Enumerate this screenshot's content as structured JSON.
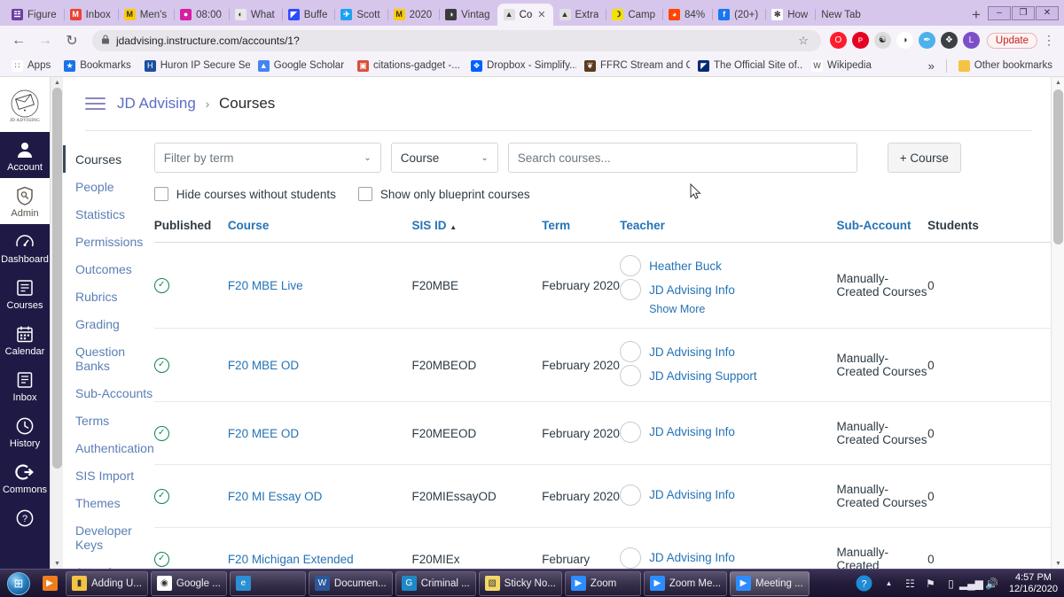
{
  "browser": {
    "tabs": [
      {
        "label": "Figure",
        "icon": "figure-icon",
        "color": "#6b3fa0",
        "glyph": "☳"
      },
      {
        "label": "Inbox",
        "icon": "gmail-icon",
        "color": "#ea4335",
        "glyph": "M"
      },
      {
        "label": "Men's",
        "icon": "mgo-icon",
        "color": "#ffcb05",
        "glyph": "M"
      },
      {
        "label": "08:00",
        "icon": "clock-icon",
        "color": "#d61fa1",
        "glyph": "●"
      },
      {
        "label": "What",
        "icon": "cloud-icon",
        "color": "#e8e8e8",
        "glyph": "◐"
      },
      {
        "label": "Buffe",
        "icon": "buffer-icon",
        "color": "#2c4bff",
        "glyph": "◤"
      },
      {
        "label": "Scott",
        "icon": "twitter-icon",
        "color": "#1da1f2",
        "glyph": "✈"
      },
      {
        "label": "2020",
        "icon": "mgo-icon",
        "color": "#ffcb05",
        "glyph": "M"
      },
      {
        "label": "Vintag",
        "icon": "globe-icon",
        "color": "#3b3b3b",
        "glyph": "◑"
      },
      {
        "label": "Co",
        "icon": "canvas-icon",
        "color": "#e0e0e0",
        "glyph": "▲",
        "active": true,
        "closable": true
      },
      {
        "label": "Extra",
        "icon": "canvas-icon",
        "color": "#e0e0e0",
        "glyph": "▲"
      },
      {
        "label": "Camp",
        "icon": "camp-icon",
        "color": "#f2e200",
        "glyph": "☽"
      },
      {
        "label": "84%",
        "icon": "reddit-icon",
        "color": "#ff4500",
        "glyph": "◕"
      },
      {
        "label": "(20+)",
        "icon": "facebook-icon",
        "color": "#1877f2",
        "glyph": "f"
      },
      {
        "label": "How",
        "icon": "spinner-icon",
        "color": "#ffffff",
        "glyph": "✻"
      },
      {
        "label": "New Tab",
        "icon": "newtab-icon",
        "color": "#f5f2f9",
        "glyph": ""
      }
    ],
    "new_tab_label": "+",
    "window_controls": {
      "minimize": "–",
      "maximize": "❐",
      "close": "✕"
    },
    "nav": {
      "back": "←",
      "forward": "→",
      "reload": "↻"
    },
    "url": "jdadvising.instructure.com/accounts/1?",
    "lock": "🔒",
    "star": "☆",
    "extensions": [
      {
        "name": "opera-extension",
        "color": "#ff1b2d",
        "glyph": "O"
      },
      {
        "name": "pinterest-extension",
        "color": "#e60023",
        "glyph": "ᴘ"
      },
      {
        "name": "grammarly-extension",
        "color": "#dcdcdc",
        "glyph": "☯"
      },
      {
        "name": "panda-extension",
        "color": "#ffffff",
        "glyph": "◑"
      },
      {
        "name": "honey-extension",
        "color": "#4db2ec",
        "glyph": "✒"
      },
      {
        "name": "puzzle-extension",
        "color": "#3c4043",
        "glyph": "❖"
      },
      {
        "name": "profile-avatar",
        "color": "#7b4fc9",
        "glyph": "L"
      }
    ],
    "update_label": "Update",
    "menu_glyph": "⋮",
    "bookmarks": [
      {
        "label": "Apps",
        "icon": "apps-grid-icon",
        "color": "#ffffff",
        "glyph": "∷"
      },
      {
        "label": "Bookmarks",
        "icon": "star-icon",
        "color": "#1a73e8",
        "glyph": "★"
      },
      {
        "label": "Huron IP Secure Se...",
        "icon": "huron-icon",
        "color": "#1a4fa0",
        "glyph": "H"
      },
      {
        "label": "Google Scholar",
        "icon": "scholar-icon",
        "color": "#4285f4",
        "glyph": "▲"
      },
      {
        "label": "citations-gadget -...",
        "icon": "citations-icon",
        "color": "#d94f3d",
        "glyph": "▣"
      },
      {
        "label": "Dropbox - Simplify...",
        "icon": "dropbox-icon",
        "color": "#0061ff",
        "glyph": "❖"
      },
      {
        "label": "FFRC Stream and C...",
        "icon": "ffrc-icon",
        "color": "#5c3b1e",
        "glyph": "❦"
      },
      {
        "label": "The Official Site of...",
        "icon": "mlb-icon",
        "color": "#002d72",
        "glyph": "◤"
      },
      {
        "label": "Wikipedia",
        "icon": "wikipedia-icon",
        "color": "#ffffff",
        "glyph": "W"
      }
    ],
    "overflow_label": "»",
    "other_bookmarks": {
      "label": "Other bookmarks",
      "icon": "folder-icon",
      "glyph": "▮"
    }
  },
  "canvas": {
    "global_nav": {
      "logo_text": "JD ADVISING",
      "items": [
        {
          "label": "Account",
          "icon": "user-icon",
          "active": false
        },
        {
          "label": "Admin",
          "icon": "shield-key-icon",
          "active": true
        },
        {
          "label": "Dashboard",
          "icon": "speedometer-icon",
          "active": false
        },
        {
          "label": "Courses",
          "icon": "book-icon",
          "active": false
        },
        {
          "label": "Calendar",
          "icon": "calendar-icon",
          "active": false
        },
        {
          "label": "Inbox",
          "icon": "envelope-icon",
          "active": false
        },
        {
          "label": "History",
          "icon": "clock-icon",
          "active": false
        },
        {
          "label": "Commons",
          "icon": "arrow-out-icon",
          "active": false
        },
        {
          "label": "",
          "icon": "help-question-icon",
          "active": false
        }
      ]
    },
    "breadcrumb": {
      "root": "JD Advising",
      "separator": "›",
      "current": "Courses"
    },
    "account_nav": [
      {
        "label": "Courses",
        "active": true
      },
      {
        "label": "People",
        "active": false
      },
      {
        "label": "Statistics",
        "active": false
      },
      {
        "label": "Permissions",
        "active": false
      },
      {
        "label": "Outcomes",
        "active": false
      },
      {
        "label": "Rubrics",
        "active": false
      },
      {
        "label": "Grading",
        "active": false
      },
      {
        "label": "Question Banks",
        "active": false
      },
      {
        "label": "Sub-Accounts",
        "active": false
      },
      {
        "label": "Terms",
        "active": false
      },
      {
        "label": "Authentication",
        "active": false
      },
      {
        "label": "SIS Import",
        "active": false
      },
      {
        "label": "Themes",
        "active": false
      },
      {
        "label": "Developer Keys",
        "active": false
      },
      {
        "label": "Attendance",
        "active": false
      }
    ],
    "filters": {
      "term_placeholder": "Filter by term",
      "type_value": "Course",
      "search_placeholder": "Search courses...",
      "add_course_label": "+ Course",
      "hide_without_students_label": "Hide courses without students",
      "blueprint_only_label": "Show only blueprint courses"
    },
    "table": {
      "columns": [
        "Published",
        "Course",
        "SIS ID",
        "Term",
        "Teacher",
        "Sub-Account",
        "Students"
      ],
      "sorted_column": "SIS ID",
      "sort_indicator": "▲",
      "show_more_label": "Show More",
      "rows": [
        {
          "published": true,
          "course": "F20 MBE Live",
          "sis_id": "F20MBE",
          "term": "February 2020",
          "teachers": [
            "Heather Buck",
            "JD Advising Info"
          ],
          "show_more": true,
          "sub_account": "Manually-Created Courses",
          "students": "0"
        },
        {
          "published": true,
          "course": "F20 MBE OD",
          "sis_id": "F20MBEOD",
          "term": "February 2020",
          "teachers": [
            "JD Advising Info",
            "JD Advising Support"
          ],
          "show_more": false,
          "sub_account": "Manually-Created Courses",
          "students": "0"
        },
        {
          "published": true,
          "course": "F20 MEE OD",
          "sis_id": "F20MEEOD",
          "term": "February 2020",
          "teachers": [
            "JD Advising Info"
          ],
          "show_more": false,
          "sub_account": "Manually-Created Courses",
          "students": "0"
        },
        {
          "published": true,
          "course": "F20 MI Essay OD",
          "sis_id": "F20MIEssayOD",
          "term": "February 2020",
          "teachers": [
            "JD Advising Info"
          ],
          "show_more": false,
          "sub_account": "Manually-Created Courses",
          "students": "0"
        },
        {
          "published": true,
          "course": "F20 Michigan Extended",
          "sis_id": "F20MIEx",
          "term": "February",
          "teachers": [
            "JD Advising Info"
          ],
          "show_more": false,
          "sub_account": "Manually-Created",
          "students": "0"
        }
      ]
    }
  },
  "taskbar": {
    "start_glyph": "⊞",
    "quick_launch": [
      {
        "name": "media-player-icon",
        "color": "#f07c1e",
        "glyph": "▶"
      }
    ],
    "buttons": [
      {
        "label": "Adding U...",
        "icon": "folder-icon",
        "color": "#f5c344",
        "glyph": "▮",
        "active": false
      },
      {
        "label": "Google ...",
        "icon": "chrome-icon",
        "color": "#ffffff",
        "glyph": "◉",
        "active": false
      },
      {
        "label": "",
        "icon": "internet-explorer-icon",
        "color": "#2a8fd4",
        "glyph": "e",
        "active": false
      },
      {
        "label": "Documen...",
        "icon": "word-icon",
        "color": "#2b579a",
        "glyph": "W",
        "active": false
      },
      {
        "label": "Criminal ...",
        "icon": "pdf-icon",
        "color": "#1e88c7",
        "glyph": "G",
        "active": false
      },
      {
        "label": "Sticky No...",
        "icon": "sticky-notes-icon",
        "color": "#f4d96a",
        "glyph": "▧",
        "active": false
      },
      {
        "label": "Zoom",
        "icon": "zoom-icon",
        "color": "#2d8cff",
        "glyph": "▶",
        "active": false
      },
      {
        "label": "Zoom Me...",
        "icon": "zoom-icon",
        "color": "#2d8cff",
        "glyph": "▶",
        "active": false
      },
      {
        "label": "Meeting ...",
        "icon": "zoom-icon",
        "color": "#2d8cff",
        "glyph": "▶",
        "active": true
      }
    ],
    "tray": {
      "help_glyph": "?",
      "chevron": "▲",
      "icons": [
        {
          "name": "network-icon",
          "glyph": "☷"
        },
        {
          "name": "flag-icon",
          "glyph": "⚑"
        },
        {
          "name": "battery-icon",
          "glyph": "▯"
        },
        {
          "name": "signal-icon",
          "glyph": "▂▄▆"
        },
        {
          "name": "volume-icon",
          "glyph": "🔊"
        }
      ],
      "time": "4:57 PM",
      "date": "12/16/2020"
    }
  },
  "colors": {
    "canvas_nav": "#1e1a45",
    "link": "#2573b5",
    "published": "#0b874b",
    "titlebar": "#d7c6ec"
  }
}
